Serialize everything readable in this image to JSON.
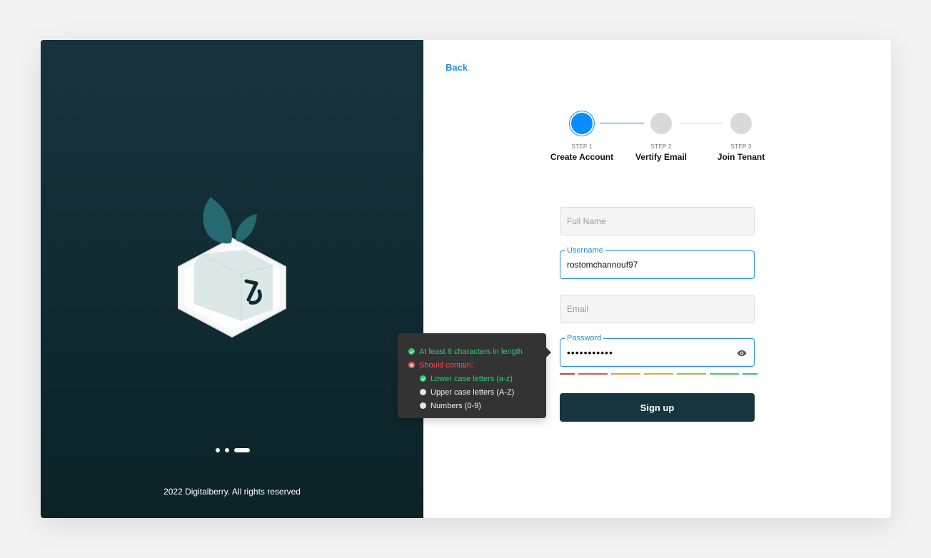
{
  "brand": {
    "copyright": "2022 Digitalberry. All rights reserved",
    "carousel": {
      "count": 3,
      "active_index": 2
    },
    "colors": {
      "panel": "#18333d",
      "leaf": "#256a70"
    }
  },
  "nav": {
    "back_label": "Back"
  },
  "stepper": {
    "steps": [
      {
        "number": "STEP 1",
        "title": "Create Account",
        "state": "active"
      },
      {
        "number": "STEP 2",
        "title": "Vertify Email",
        "state": "inactive"
      },
      {
        "number": "STEP 3",
        "title": "Join Tenant",
        "state": "inactive"
      }
    ]
  },
  "form": {
    "full_name": {
      "placeholder": "Full Name",
      "value": ""
    },
    "username": {
      "label": "Username",
      "value": "rostomchannouf97"
    },
    "email": {
      "placeholder": "Email",
      "value": ""
    },
    "password": {
      "label": "Password",
      "value": "•••••••••••",
      "toggle_icon": "eye-icon"
    },
    "strength_colors": [
      "#d93a2b",
      "#e5553a",
      "#e89a3a",
      "#c9b43e",
      "#8ec63f",
      "#4cc66b",
      "#2ecc71"
    ],
    "submit_label": "Sign up"
  },
  "password_rules": {
    "min_length": {
      "text": "At least 8 characters in length",
      "status": "ok"
    },
    "contain": {
      "text": "Should contain:",
      "status": "bad"
    },
    "items": [
      {
        "text": "Lower case letters (a-z)",
        "status": "ok"
      },
      {
        "text": "Upper case letters (A-Z)",
        "status": "none"
      },
      {
        "text": "Numbers (0-9)",
        "status": "none"
      }
    ]
  },
  "colors": {
    "accent": "#1e8fe1",
    "step_active": "#0a8cff",
    "button": "#17353f",
    "ok": "#2ecc71",
    "error": "#ff4d4f"
  }
}
